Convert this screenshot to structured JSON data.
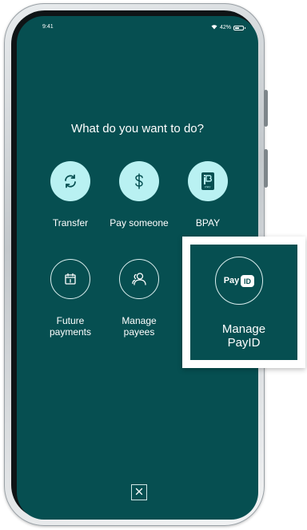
{
  "status_bar": {
    "time": "9:41",
    "battery": "42%"
  },
  "main": {
    "heading": "What do you want to do?",
    "actions": [
      {
        "label": "Transfer",
        "icon": "transfer-arrows-icon"
      },
      {
        "label": "Pay someone",
        "icon": "dollar-icon"
      },
      {
        "label": "BPAY",
        "icon": "bpay-icon"
      },
      {
        "label_line1": "Future",
        "label_line2": "payments",
        "icon": "calendar-icon"
      },
      {
        "label_line1": "Manage",
        "label_line2": "payees",
        "icon": "payees-icon"
      }
    ],
    "close_icon": "close-icon"
  },
  "callout": {
    "logo_text": "Pay",
    "logo_badge": "ID",
    "label_line1": "Manage",
    "label_line2": "PayID"
  },
  "colors": {
    "screen_bg": "#064f51",
    "accent_circle": "#b9f1f2",
    "text": "#ffffff"
  }
}
